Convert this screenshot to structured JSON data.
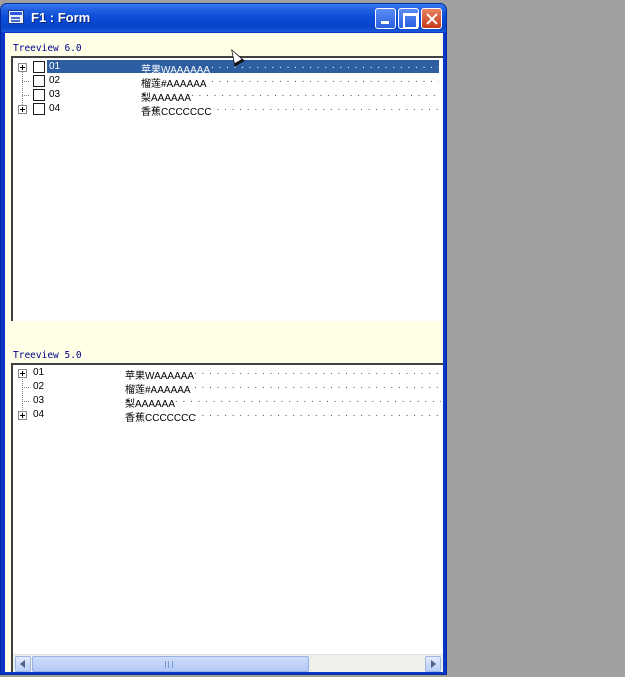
{
  "window": {
    "title": "F1 : Form"
  },
  "treeview_v6": {
    "label": "Treeview 6.0",
    "items": [
      {
        "id": "01",
        "name": "苹果WAAAAAA",
        "dots": ". . . . . . . . . . . . . . . . . . . . . . . . . . . . . . . . . . . . . . . . . . . . .",
        "expandable": true,
        "selected": true
      },
      {
        "id": "02",
        "name": "榴莲#AAAAAA",
        "dots": ". . . . . . . . . . . . . . . . . . . . . . . . . . . . . . . . . . . . . . . . . . . . . .",
        "expandable": false,
        "selected": false
      },
      {
        "id": "03",
        "name": "梨AAAAAA",
        "dots": ". . . . . . . . . . . . . . . . . . . . . . . . . . . . . . . . . . . . . . . . . . . . . . . .",
        "expandable": false,
        "selected": false
      },
      {
        "id": "04",
        "name": "香蕉CCCCCCC",
        "dots": ". . . . . . . . . . . . . . . . . . . . . . . . . . . . . . . . . . . . . . . . . . . . .",
        "expandable": true,
        "selected": false
      }
    ]
  },
  "treeview_v5": {
    "label": "Treeview 5.0",
    "items": [
      {
        "id": "01",
        "name": "苹果WAAAAAA",
        "dots": ". . . . . . . . . . . . . . . . . . . . . . . . . . . . . . . . . . . . . . . . . . . . . . . . .",
        "expandable": true
      },
      {
        "id": "02",
        "name": "榴莲#AAAAAA",
        "dots": ". . . . . . . . . . . . . . . . . . . . . . . . . . . . . . . . . . . . . . . . . . . . . . . . .",
        "expandable": false
      },
      {
        "id": "03",
        "name": "梨AAAAAA",
        "dots": ". . . . . . . . . . . . . . . . . . . . . . . . . . . . . . . . . . . . . . . . . . . . . . . . . . .",
        "expandable": false
      },
      {
        "id": "04",
        "name": "香蕉CCCCCCC",
        "dots": ". . . . . . . . . . . . . . . . . . . . . . . . . . . . . . . . . . . . . . . . . . . . . . . .",
        "expandable": true
      }
    ]
  },
  "scrollbar": {
    "position": 0,
    "visible_fraction": 0.66
  },
  "colors": {
    "titlebar": "#0a4cd8",
    "selection": "#2e5ea2",
    "form_background": "#ffffe8",
    "label_text": "#00008a",
    "desktop": "#a0a0a0"
  },
  "icons": [
    "app-icon",
    "minimize-icon",
    "maximize-icon",
    "close-icon",
    "plus-expander-icon",
    "checkbox",
    "scroll-left-icon",
    "scroll-right-icon",
    "mouse-cursor-icon"
  ]
}
